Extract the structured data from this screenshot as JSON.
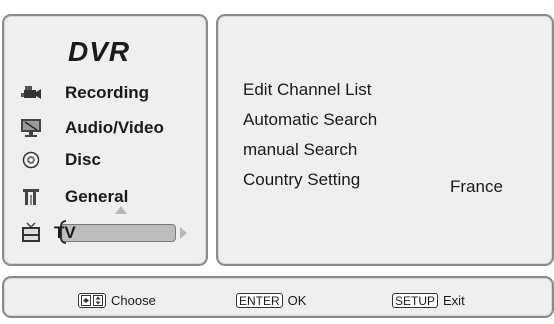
{
  "sidebar": {
    "title": "DVR",
    "items": [
      {
        "label": "Recording",
        "icon": "camcorder-icon"
      },
      {
        "label": "Audio/Video",
        "icon": "monitor-icon"
      },
      {
        "label": "Disc",
        "icon": "disc-icon"
      },
      {
        "label": "General",
        "icon": "general-settings-icon"
      },
      {
        "label": "TV",
        "icon": "tv-icon",
        "selected": true
      }
    ]
  },
  "content": {
    "options": [
      {
        "label": "Edit Channel List"
      },
      {
        "label": "Automatic Search"
      },
      {
        "label": "manual Search"
      },
      {
        "label": "Country Setting",
        "value": "France"
      }
    ]
  },
  "footer": {
    "choose_label": "Choose",
    "enter_key": "ENTER",
    "ok_label": "OK",
    "setup_key": "SETUP",
    "exit_label": "Exit"
  },
  "colors": {
    "panel_bg": "#efefef",
    "panel_border": "#8a8a8a",
    "highlight": "#bdbdbd"
  }
}
